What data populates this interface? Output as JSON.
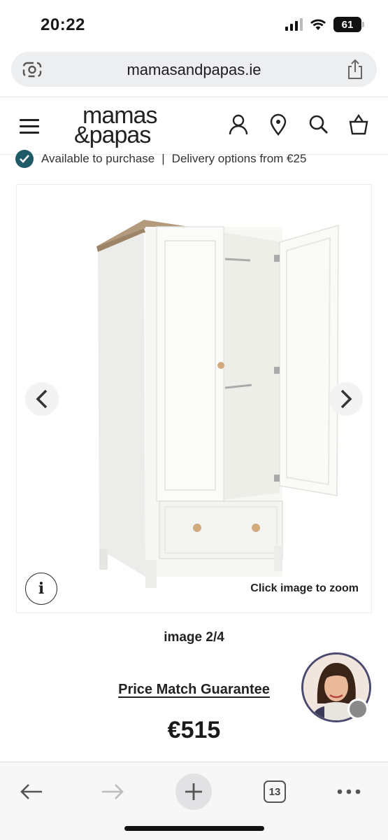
{
  "status_bar": {
    "time": "20:22",
    "battery": "61"
  },
  "url_bar": {
    "url": "mamasandpapas.ie",
    "left_icon": "lens-search-icon",
    "right_icon": "share-icon"
  },
  "header": {
    "logo_line1": "mamas",
    "logo_line2": "&papas",
    "icons": [
      "menu-icon",
      "account-icon",
      "store-locator-icon",
      "search-icon",
      "basket-icon"
    ]
  },
  "availability": {
    "status": "Available to purchase",
    "separator": "|",
    "delivery": "Delivery options from €25"
  },
  "gallery": {
    "zoom_hint": "Click image to zoom",
    "info_label": "i",
    "counter": "image 2/4"
  },
  "product": {
    "price_match": "Price Match Guarantee",
    "price": "€515"
  },
  "browser_toolbar": {
    "tabs_count": "13"
  },
  "colors": {
    "accent_teal": "#1e5b66",
    "avatar_ring": "#4a4a6e"
  }
}
